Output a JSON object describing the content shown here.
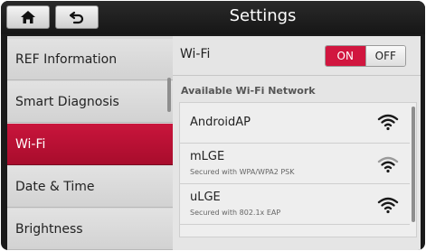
{
  "header": {
    "title": "Settings",
    "home_icon": "home-icon",
    "back_icon": "back-icon"
  },
  "sidebar": {
    "items": [
      {
        "label": "REF Information",
        "active": false
      },
      {
        "label": "Smart Diagnosis",
        "active": false
      },
      {
        "label": "Wi-Fi",
        "active": true
      },
      {
        "label": "Date & Time",
        "active": false
      },
      {
        "label": "Brightness",
        "active": false
      }
    ]
  },
  "wifi": {
    "label": "Wi-Fi",
    "on_label": "ON",
    "off_label": "OFF",
    "state": "ON",
    "available_heading": "Available Wi-Fi Network",
    "networks": [
      {
        "name": "AndroidAP",
        "security": "",
        "signal_icon": "wifi-signal-icon"
      },
      {
        "name": "mLGE",
        "security": "Secured with WPA/WPA2 PSK",
        "signal_icon": "wifi-signal-icon"
      },
      {
        "name": "uLGE",
        "security": "Secured with 802.1x EAP",
        "signal_icon": "wifi-signal-icon"
      }
    ]
  },
  "colors": {
    "accent": "#c8143c",
    "header_bg": "#1a1a1a",
    "panel_bg": "#e5e5e5"
  }
}
